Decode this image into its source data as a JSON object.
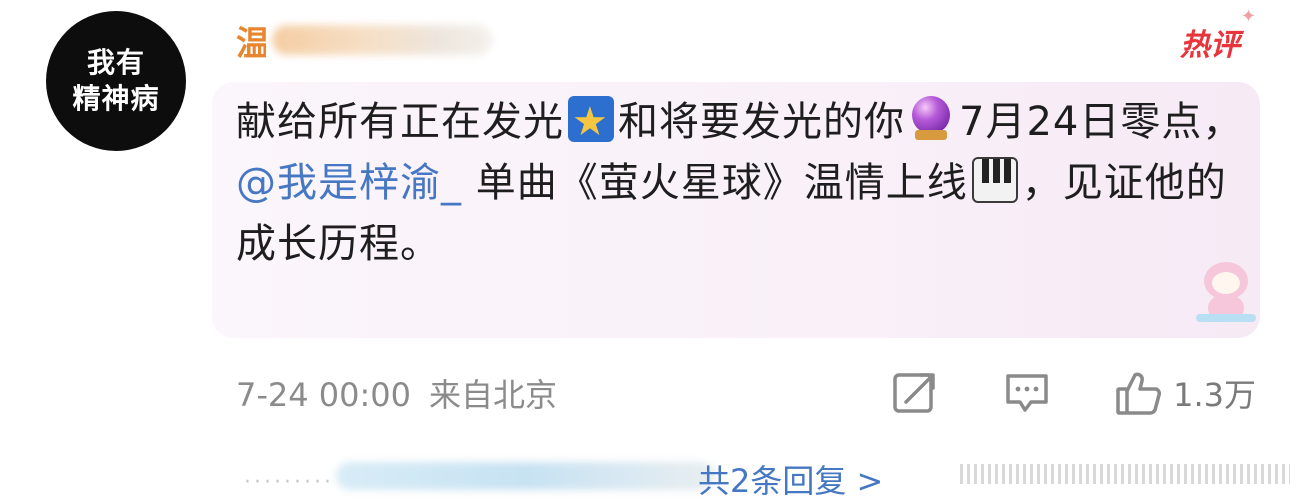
{
  "avatar": {
    "line1": "我有",
    "line2": "精神病"
  },
  "user": {
    "name_visible": "温"
  },
  "badge": {
    "label": "热评"
  },
  "comment": {
    "seg1": "献给所有正在发光",
    "seg2": "和将要发光的你",
    "seg3": "7月24日零点，",
    "mention": "@我是梓渝_",
    "seg4": " 单曲《萤火星球》温情上线",
    "seg5": "，见证他的成长历程。"
  },
  "icons": {
    "emoji1": "glowing-star-icon",
    "emoji2": "crystal-ball-icon",
    "emoji3": "piano-keyboard-icon",
    "sticker": "pink-cat-sticker-icon",
    "share": "share-icon",
    "comment": "comment-icon",
    "like": "thumbs-up-icon"
  },
  "footer": {
    "time": "7-24 00:00",
    "source": "来自北京",
    "like_count": "1.3万"
  },
  "replies": {
    "link": "共2条回复 >"
  },
  "colors": {
    "mention": "#4577c3",
    "hot": "#e8343b",
    "username": "#e8862f"
  }
}
